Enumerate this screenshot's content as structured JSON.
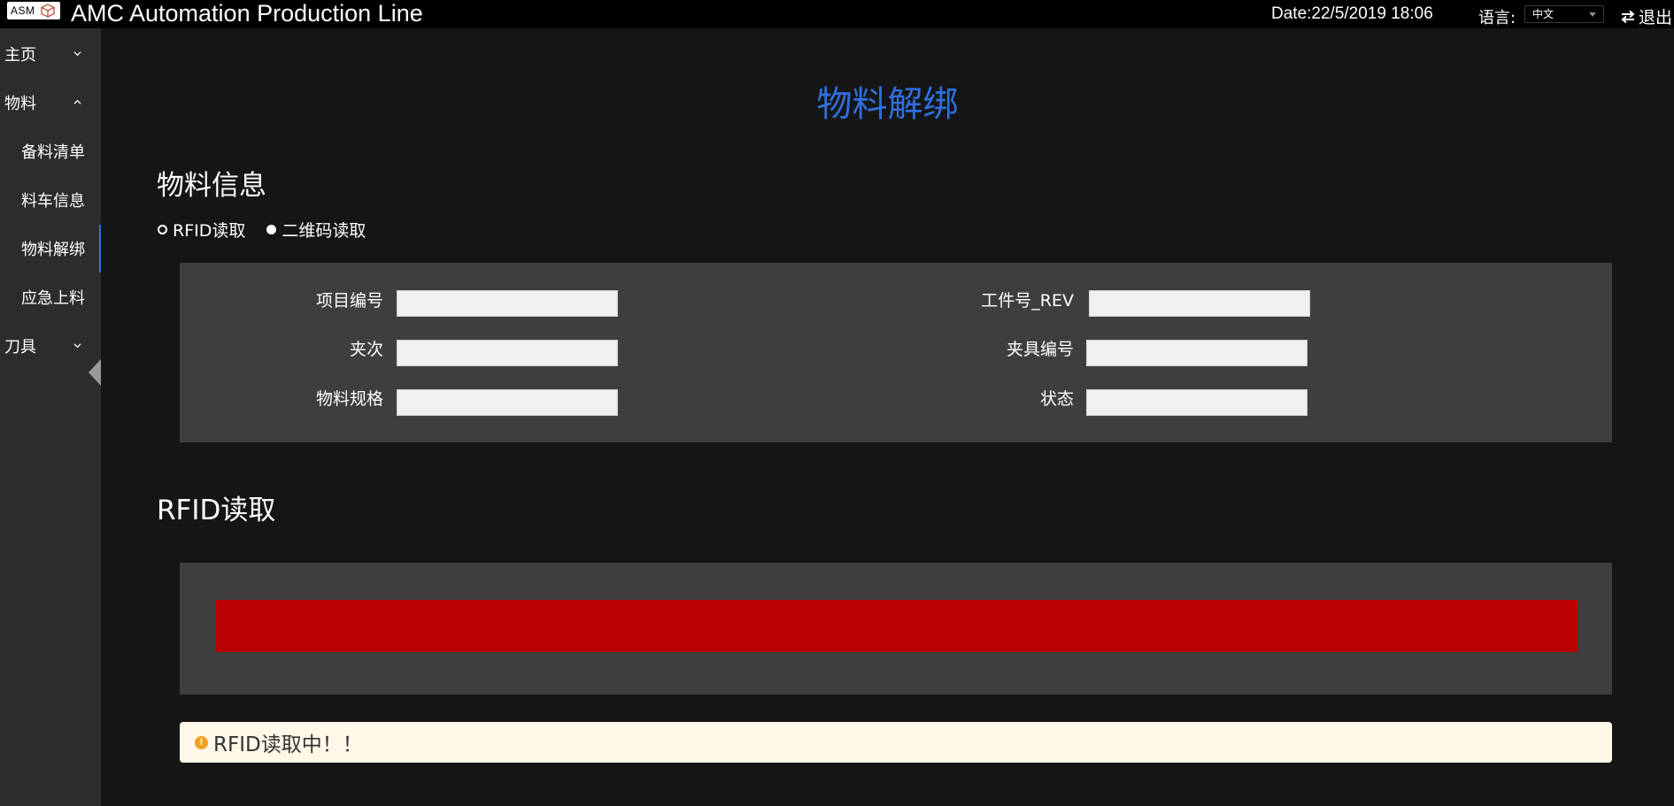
{
  "header": {
    "logo_text": "ASM",
    "app_title": "AMC Automation Production Line",
    "date": "Date:22/5/2019 18:06",
    "language_label": "语言:",
    "language_value": "中文",
    "logout_label": "退出"
  },
  "sidebar": {
    "items": [
      {
        "label": "主页",
        "expanded": false
      },
      {
        "label": "物料",
        "expanded": true
      },
      {
        "label": "备料清单"
      },
      {
        "label": "料车信息"
      },
      {
        "label": "物料解绑",
        "active": true
      },
      {
        "label": "应急上料"
      },
      {
        "label": "刀具",
        "expanded": false
      }
    ]
  },
  "main": {
    "page_title": "物料解绑",
    "material_section_title": "物料信息",
    "read_modes": [
      {
        "label": "RFID读取",
        "selected": false
      },
      {
        "label": "二维码读取",
        "selected": true
      }
    ],
    "fields": {
      "project_no": {
        "label": "项目编号",
        "value": ""
      },
      "batch": {
        "label": "夹次",
        "value": ""
      },
      "material_spec": {
        "label": "物料规格",
        "value": ""
      },
      "workpiece_rev": {
        "label": "工件号_REV",
        "value": ""
      },
      "fixture_no": {
        "label": "夹具编号",
        "value": ""
      },
      "status": {
        "label": "状态",
        "value": ""
      }
    },
    "rfid_section_title": "RFID读取",
    "rfid_status_color": "#b80000",
    "alert_text": "RFID读取中！！"
  },
  "colors": {
    "accent": "#2f6fdf",
    "alert_bg": "#fff7e8",
    "alert_icon": "#f0a020"
  }
}
